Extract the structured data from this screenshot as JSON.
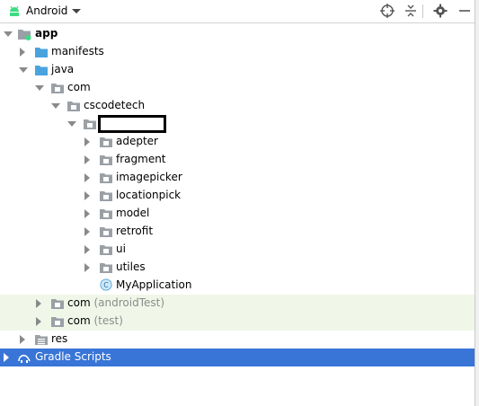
{
  "toolbar": {
    "title": "Android",
    "icons": [
      "android-icon",
      "target-icon",
      "collapse-all-icon",
      "gear-icon",
      "minimize-icon"
    ]
  },
  "tree": {
    "app": "app",
    "manifests": "manifests",
    "java": "java",
    "com": "com",
    "cscodetech": "cscodetech",
    "adepter": "adepter",
    "fragment": "fragment",
    "imagepicker": "imagepicker",
    "locationpick": "locationpick",
    "model": "model",
    "retrofit": "retrofit",
    "ui": "ui",
    "utiles": "utiles",
    "myapplication": "MyApplication",
    "class_icon_letter": "C",
    "com_android_test": "com",
    "com_android_test_suffix": "(androidTest)",
    "com_test": "com",
    "com_test_suffix": "(test)",
    "res": "res",
    "gradle_scripts": "Gradle Scripts"
  },
  "colors": {
    "selection": "#3875d7",
    "test_highlight": "#f0f7e8",
    "folder_blue": "#4aa3df",
    "package_grey": "#9aa0a6",
    "android_green": "#3ddc84"
  }
}
